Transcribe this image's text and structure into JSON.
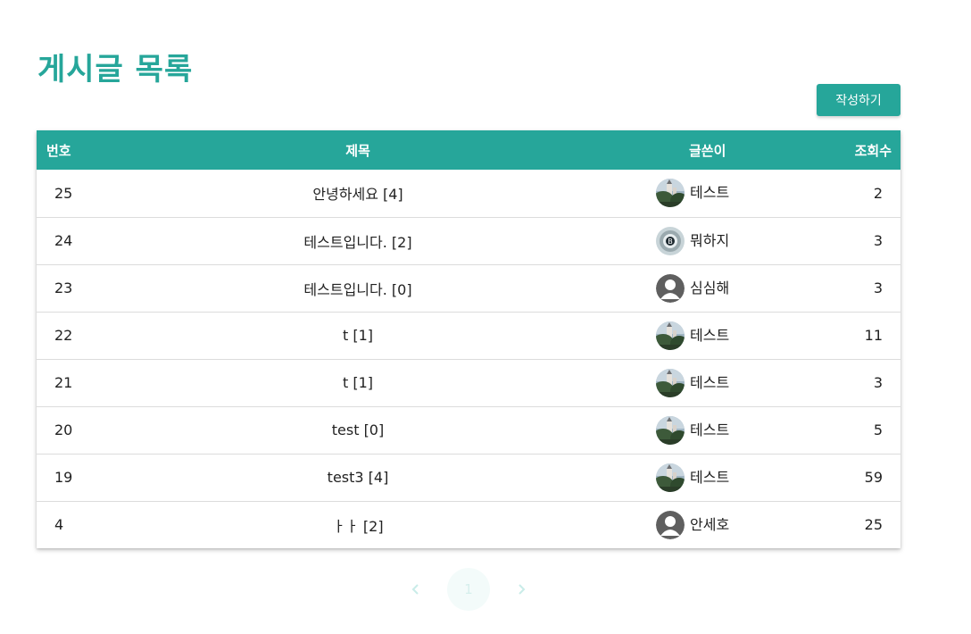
{
  "page": {
    "title": "게시글 목록",
    "write_button_label": "작성하기"
  },
  "table": {
    "headers": {
      "no": "번호",
      "title": "제목",
      "author": "글쓴이",
      "views": "조회수"
    },
    "rows": [
      {
        "no": "25",
        "title": "안녕하세요 [4]",
        "author": "테스트",
        "avatar": "castle-photo",
        "views": "2"
      },
      {
        "no": "24",
        "title": "테스트입니다. [2]",
        "author": "뭐하지",
        "avatar": "coin-photo",
        "views": "3"
      },
      {
        "no": "23",
        "title": "테스트입니다. [0]",
        "author": "심심해",
        "avatar": "default-person",
        "views": "3"
      },
      {
        "no": "22",
        "title": "t [1]",
        "author": "테스트",
        "avatar": "castle-photo",
        "views": "11"
      },
      {
        "no": "21",
        "title": "t [1]",
        "author": "테스트",
        "avatar": "castle-photo",
        "views": "3"
      },
      {
        "no": "20",
        "title": "test [0]",
        "author": "테스트",
        "avatar": "castle-photo",
        "views": "5"
      },
      {
        "no": "19",
        "title": "test3 [4]",
        "author": "테스트",
        "avatar": "castle-photo",
        "views": "59"
      },
      {
        "no": "4",
        "title": "ㅏㅏ [2]",
        "author": "안세호",
        "avatar": "default-person",
        "views": "25"
      }
    ]
  },
  "pagination": {
    "prev_icon": "chevron-left-icon",
    "current_page": "1",
    "next_icon": "chevron-right-icon"
  },
  "colors": {
    "accent": "#26a69a",
    "pagination_disabled": "#c9ece8"
  }
}
